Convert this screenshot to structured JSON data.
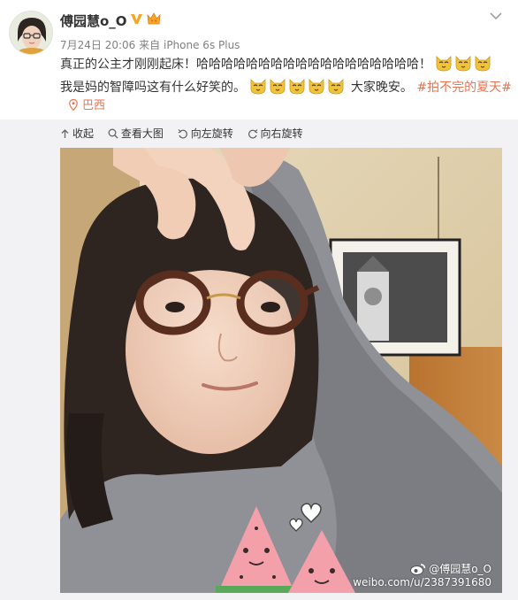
{
  "post": {
    "username": "傅园慧o_O",
    "date": "7月24日 20:06",
    "source_prefix": "来自",
    "device": "iPhone 6s Plus",
    "text_line1": "真正的公主才刚刚起床！哈哈哈哈哈哈哈哈哈哈哈哈哈哈哈哈哈哈！",
    "text_line2": "我是妈的智障吗这有什么好笑的。",
    "text_after_emoji": "大家晚安。",
    "topic": "#拍不完的夏天#",
    "location": "巴西"
  },
  "toolbar": {
    "collapse": "收起",
    "view_large": "查看大图",
    "rotate_left": "向左旋转",
    "rotate_right": "向右旋转"
  },
  "photo": {
    "watermark_name": "@傅园慧o_O",
    "watermark_url": "weibo.com/u/2387391680"
  },
  "icons": {
    "verified": "verified-v-icon",
    "crown": "crown-icon",
    "menu": "chevron-down-icon",
    "emoji": "dog-face-emoji",
    "location": "location-pin-icon"
  },
  "colors": {
    "accent": "#eb7350",
    "verified": "#f5a623",
    "meta": "#808080"
  }
}
